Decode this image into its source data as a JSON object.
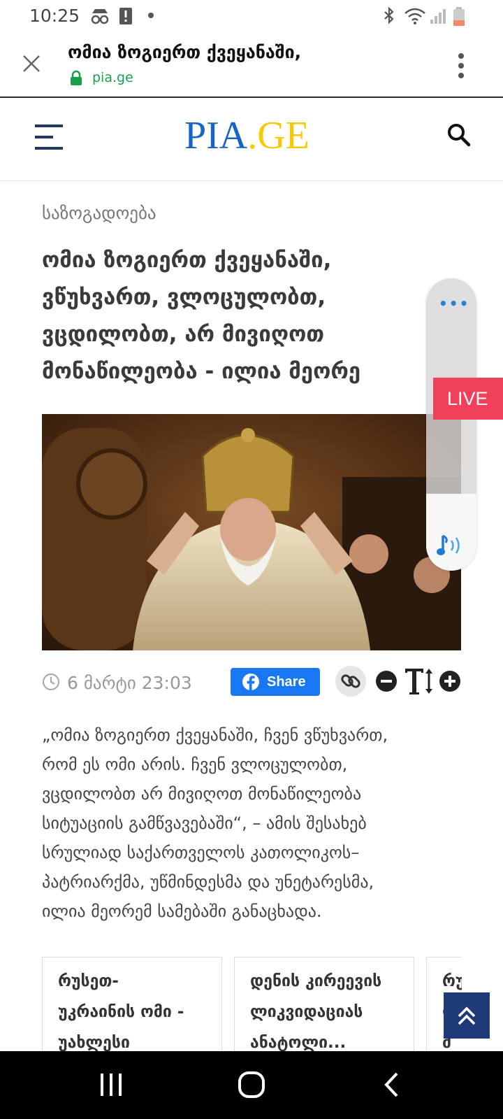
{
  "status_bar": {
    "time": "10:25",
    "icons": [
      "incognito-icon",
      "alert-icon",
      "dot-icon",
      "bluetooth-icon",
      "wifi-icon",
      "signal-icon",
      "battery-icon"
    ]
  },
  "browser": {
    "tab_title": "ომია ზოგიერთ ქვეყანაში,",
    "url": "pia.ge",
    "icons": [
      "close-icon",
      "lock-icon",
      "more-vert-icon"
    ]
  },
  "site_header": {
    "logo_pia": "PIA",
    "logo_dot": ".",
    "logo_ge": "GE",
    "colors": {
      "pia": "#1565c8",
      "ge": "#f6c900"
    },
    "icons": [
      "menu-icon",
      "search-icon"
    ]
  },
  "article": {
    "category": "საზოგადოება",
    "headline_lines": [
      "ომია ზოგიერთ ქვეყანაში,",
      "ვწუხვართ, ვლოცულობთ,",
      "ვცდილობთ, არ მივიღოთ",
      "მონაწილეობა - ილია მეორე"
    ],
    "date": "6 მარტი 23:03",
    "share_label": "Share",
    "body_lines": [
      "„ომია ზოგიერთ ქვეყანაში, ჩვენ ვწუხვართ,",
      "რომ ეს ომი არის. ჩვენ ვლოცულობთ,",
      "ვცდილობთ არ მივიღოთ მონაწილეობა",
      "სიტუაციის გამწვავებაში“, – ამის შესახებ",
      "სრულიად საქართველოს კათოლიკოს–",
      "პატრიარქმა, უწმინდესმა და უნეტარესმა,",
      "ილია მეორემ სამებაში განაცხადა."
    ]
  },
  "live_badge": "LIVE",
  "audio_player": {
    "dots": "•••",
    "icons": [
      "music-note-icon"
    ]
  },
  "related": [
    {
      "lines": [
        "რუსეთ-",
        "უკრაინის ომი -",
        "უახლესი"
      ]
    },
    {
      "lines": [
        "დენის კირეევის",
        "ლიკვიდაციას",
        "ანატოლი..."
      ]
    },
    {
      "lines": [
        "რუ",
        "ლ",
        "მ"
      ]
    }
  ],
  "nav_bar": {
    "icons": [
      "recents-icon",
      "home-icon",
      "back-icon"
    ]
  }
}
